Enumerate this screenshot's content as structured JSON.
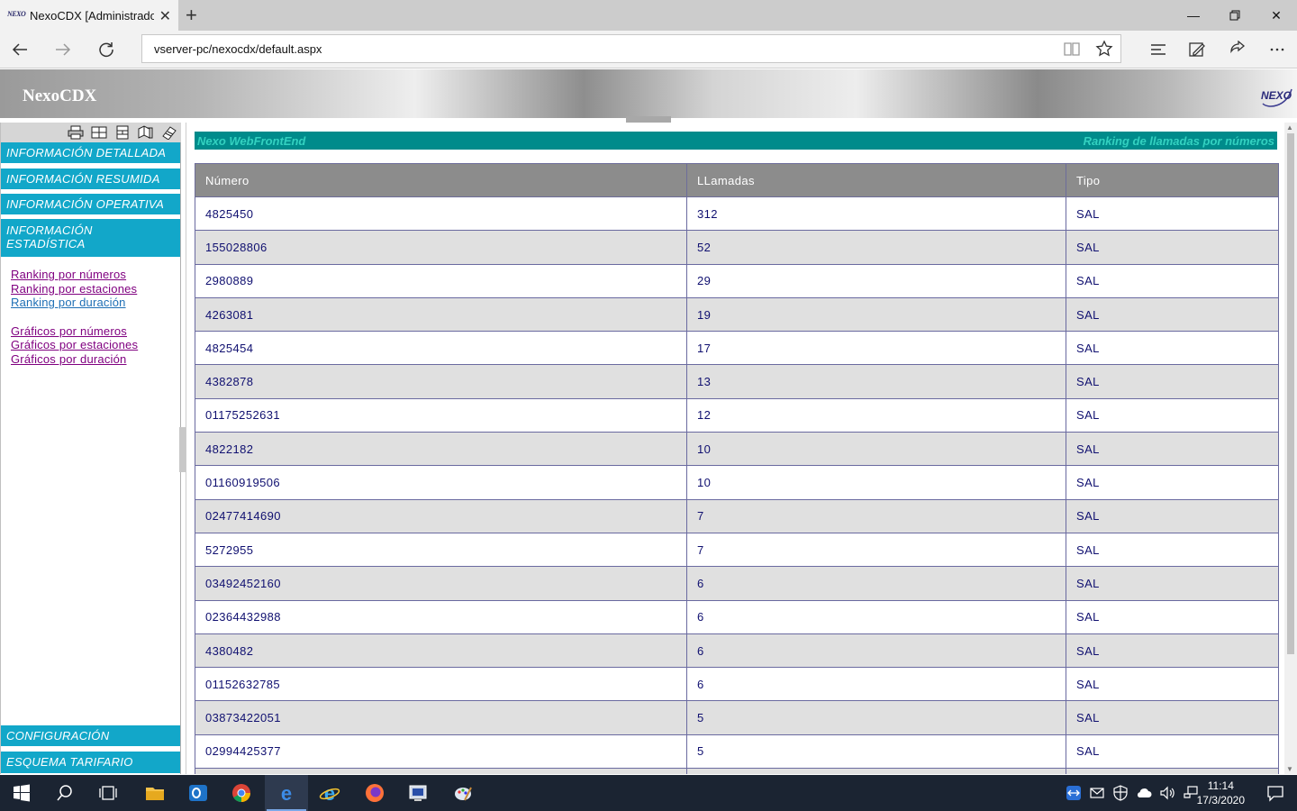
{
  "browser": {
    "tab_title": "NexoCDX [Administrador]",
    "tab_favicon": "NEXO",
    "url": "vserver-pc/nexocdx/default.aspx"
  },
  "app": {
    "title": "NexoCDX",
    "logo_text": "NEXO"
  },
  "sidebar": {
    "toolbar_icons": [
      "printer-icon",
      "grid-icon",
      "layout-icon",
      "books-icon",
      "notes-icon"
    ],
    "menu": [
      "INFORMACIÓN DETALLADA",
      "INFORMACIÓN RESUMIDA",
      "INFORMACIÓN OPERATIVA",
      "INFORMACIÓN ESTADÍSTICA"
    ],
    "links_ranking": [
      "Ranking por números",
      "Ranking por estaciones",
      "Ranking por duración"
    ],
    "links_graficos": [
      "Gráficos por números",
      "Gráficos por estaciones",
      "Gráficos por duración"
    ],
    "bottom_menu": [
      "CONFIGURACIÓN",
      "ESQUEMA TARIFARIO"
    ]
  },
  "main": {
    "banner_left": "Nexo WebFrontEnd",
    "banner_right": "Ranking de llamadas por números",
    "columns": [
      "Número",
      "LLamadas",
      "Tipo"
    ],
    "rows": [
      [
        "4825450",
        "312",
        "SAL"
      ],
      [
        "155028806",
        "52",
        "SAL"
      ],
      [
        "2980889",
        "29",
        "SAL"
      ],
      [
        "4263081",
        "19",
        "SAL"
      ],
      [
        "4825454",
        "17",
        "SAL"
      ],
      [
        "4382878",
        "13",
        "SAL"
      ],
      [
        "01175252631",
        "12",
        "SAL"
      ],
      [
        "4822182",
        "10",
        "SAL"
      ],
      [
        "01160919506",
        "10",
        "SAL"
      ],
      [
        "02477414690",
        "7",
        "SAL"
      ],
      [
        "5272955",
        "7",
        "SAL"
      ],
      [
        "03492452160",
        "6",
        "SAL"
      ],
      [
        "02364432988",
        "6",
        "SAL"
      ],
      [
        "4380482",
        "6",
        "SAL"
      ],
      [
        "01152632785",
        "6",
        "SAL"
      ],
      [
        "03873422051",
        "5",
        "SAL"
      ],
      [
        "02994425377",
        "5",
        "SAL"
      ],
      [
        "",
        "",
        ""
      ]
    ]
  },
  "taskbar": {
    "time": "11:14",
    "date": "17/3/2020"
  }
}
